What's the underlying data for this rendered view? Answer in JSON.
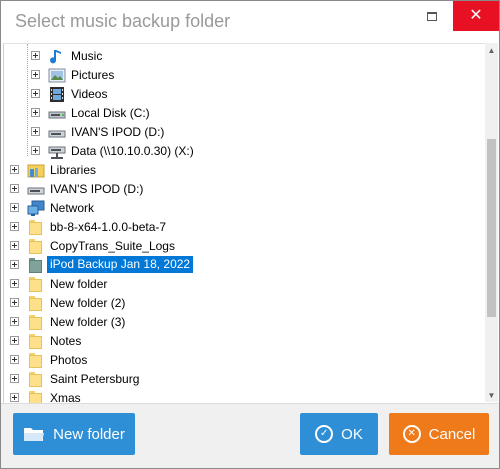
{
  "window": {
    "title": "Select music backup folder",
    "maximize_icon": "maximize-icon",
    "close_icon": "close-icon",
    "close_glyph": "✕",
    "close_color": "#e81123"
  },
  "tree": {
    "children_of_computer": [
      {
        "label": "Music",
        "icon": "music-note-icon"
      },
      {
        "label": "Pictures",
        "icon": "pictures-icon"
      },
      {
        "label": "Videos",
        "icon": "film-icon"
      },
      {
        "label": "Local Disk (C:)",
        "icon": "disk-icon"
      },
      {
        "label": "IVAN'S IPOD (D:)",
        "icon": "drive-icon"
      },
      {
        "label": "Data (\\\\10.10.0.30) (X:)",
        "icon": "network-drive-icon"
      }
    ],
    "items": [
      {
        "label": "Libraries",
        "icon": "libraries-icon"
      },
      {
        "label": "IVAN'S IPOD (D:)",
        "icon": "drive-icon"
      },
      {
        "label": "Network",
        "icon": "network-icon"
      },
      {
        "label": "bb-8-x64-1.0.0-beta-7",
        "icon": "folder-icon"
      },
      {
        "label": "CopyTrans_Suite_Logs",
        "icon": "folder-icon"
      },
      {
        "label": "iPod Backup Jan 18, 2022",
        "icon": "folder-icon",
        "selected": true
      },
      {
        "label": "New folder",
        "icon": "folder-icon"
      },
      {
        "label": "New folder (2)",
        "icon": "folder-icon"
      },
      {
        "label": "New folder (3)",
        "icon": "folder-icon"
      },
      {
        "label": "Notes",
        "icon": "folder-icon"
      },
      {
        "label": "Photos",
        "icon": "folder-icon"
      },
      {
        "label": "Saint Petersburg",
        "icon": "folder-icon"
      },
      {
        "label": "Xmas",
        "icon": "folder-icon"
      }
    ],
    "selection_color": "#0078d7"
  },
  "buttons": {
    "new_folder": "New folder",
    "ok": "OK",
    "cancel": "Cancel",
    "ok_glyph": "✓",
    "cancel_glyph": "✕",
    "blue": "#2f8fd6",
    "orange": "#ee7a1a"
  }
}
